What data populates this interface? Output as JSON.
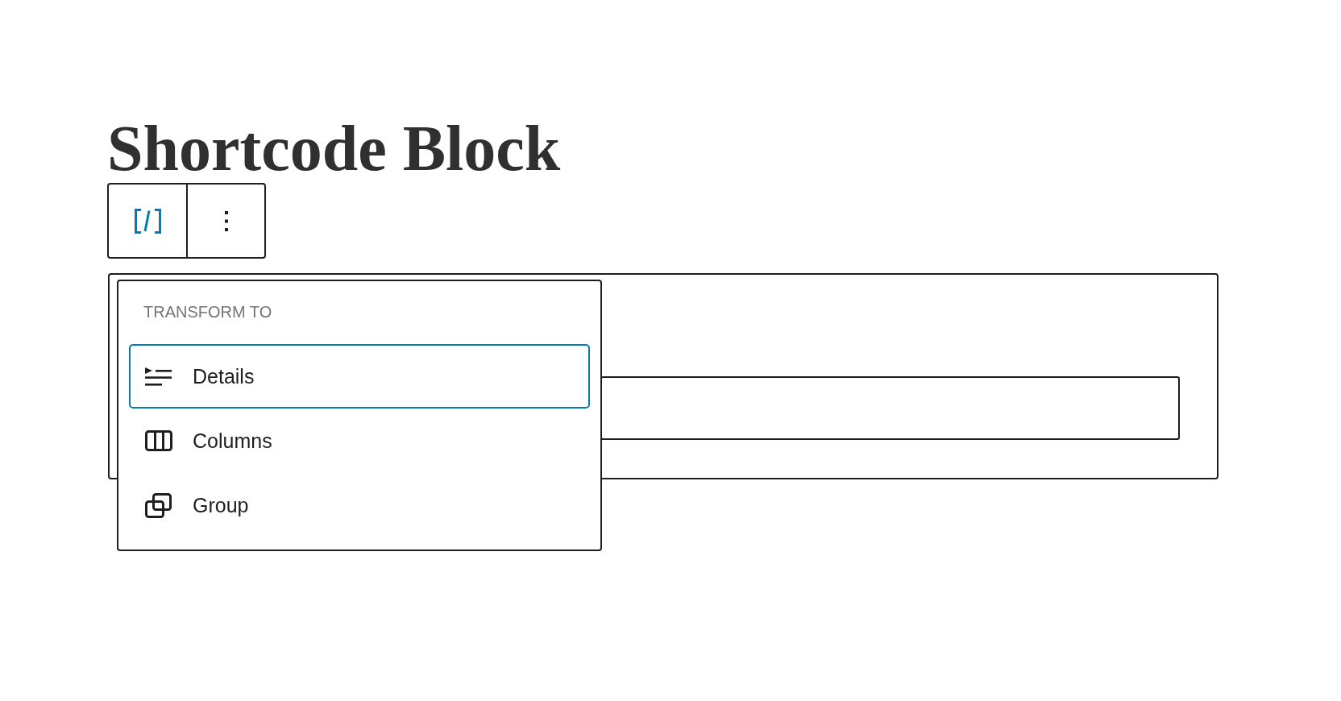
{
  "page": {
    "title": "Shortcode Block"
  },
  "transform_menu": {
    "heading": "TRANSFORM TO",
    "items": [
      {
        "label": "Details",
        "kind": "details",
        "selected": true
      },
      {
        "label": "Columns",
        "kind": "columns",
        "selected": false
      },
      {
        "label": "Group",
        "kind": "group",
        "selected": false
      }
    ]
  }
}
